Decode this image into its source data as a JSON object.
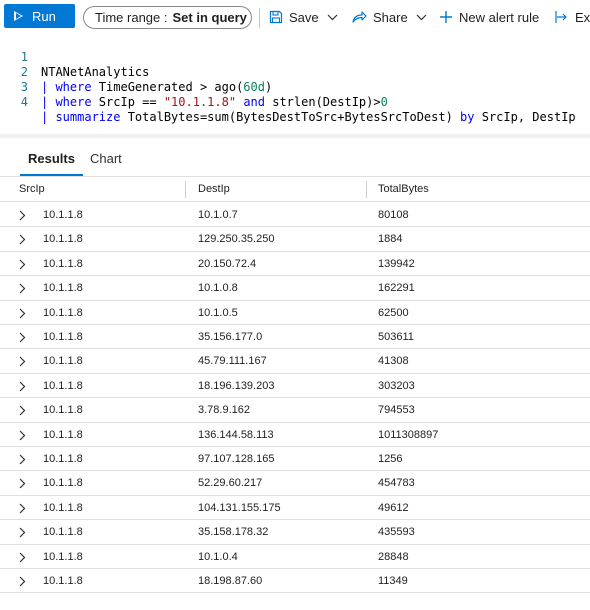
{
  "toolbar": {
    "run_label": "Run",
    "time_range_label": "Time range :",
    "time_range_value": "Set in query",
    "save_label": "Save",
    "share_label": "Share",
    "new_alert_label": "New alert rule",
    "export_label": "Exp"
  },
  "editor": {
    "lines": [
      {
        "num": "1",
        "tokens": [
          {
            "t": "NTANetAnalytics",
            "c": ""
          }
        ]
      },
      {
        "num": "2",
        "tokens": [
          {
            "t": "| ",
            "c": "kw"
          },
          {
            "t": "where",
            "c": "kw"
          },
          {
            "t": " TimeGenerated > ago(",
            "c": ""
          },
          {
            "t": "60d",
            "c": "num"
          },
          {
            "t": ")",
            "c": ""
          }
        ]
      },
      {
        "num": "3",
        "tokens": [
          {
            "t": "| ",
            "c": "kw"
          },
          {
            "t": "where",
            "c": "kw"
          },
          {
            "t": " SrcIp == ",
            "c": ""
          },
          {
            "t": "\"10.1.1.8\"",
            "c": "str"
          },
          {
            "t": " ",
            "c": ""
          },
          {
            "t": "and",
            "c": "kw"
          },
          {
            "t": " strlen(DestIp)>",
            "c": ""
          },
          {
            "t": "0",
            "c": "num"
          }
        ]
      },
      {
        "num": "4",
        "tokens": [
          {
            "t": "| ",
            "c": "kw"
          },
          {
            "t": "summarize",
            "c": "kw"
          },
          {
            "t": " TotalBytes=sum(BytesDestToSrc+BytesSrcToDest) ",
            "c": ""
          },
          {
            "t": "by",
            "c": "kw"
          },
          {
            "t": " SrcIp, DestIp",
            "c": ""
          }
        ]
      }
    ]
  },
  "tabs": {
    "results": "Results",
    "chart": "Chart"
  },
  "table": {
    "columns": [
      "SrcIp",
      "DestIp",
      "TotalBytes"
    ],
    "rows": [
      [
        "10.1.1.8",
        "10.1.0.7",
        "80108"
      ],
      [
        "10.1.1.8",
        "129.250.35.250",
        "1884"
      ],
      [
        "10.1.1.8",
        "20.150.72.4",
        "139942"
      ],
      [
        "10.1.1.8",
        "10.1.0.8",
        "162291"
      ],
      [
        "10.1.1.8",
        "10.1.0.5",
        "62500"
      ],
      [
        "10.1.1.8",
        "35.156.177.0",
        "503611"
      ],
      [
        "10.1.1.8",
        "45.79.111.167",
        "41308"
      ],
      [
        "10.1.1.8",
        "18.196.139.203",
        "303203"
      ],
      [
        "10.1.1.8",
        "3.78.9.162",
        "794553"
      ],
      [
        "10.1.1.8",
        "136.144.58.113",
        "1011308897"
      ],
      [
        "10.1.1.8",
        "97.107.128.165",
        "1256"
      ],
      [
        "10.1.1.8",
        "52.29.60.217",
        "454783"
      ],
      [
        "10.1.1.8",
        "104.131.155.175",
        "49612"
      ],
      [
        "10.1.1.8",
        "35.158.178.32",
        "435593"
      ],
      [
        "10.1.1.8",
        "10.1.0.4",
        "28848"
      ],
      [
        "10.1.1.8",
        "18.198.87.60",
        "11349"
      ]
    ]
  },
  "colors": {
    "accent": "#0078d4",
    "keyword": "#0000ff",
    "string": "#a31515",
    "number": "#098658",
    "line_number": "#237893"
  }
}
